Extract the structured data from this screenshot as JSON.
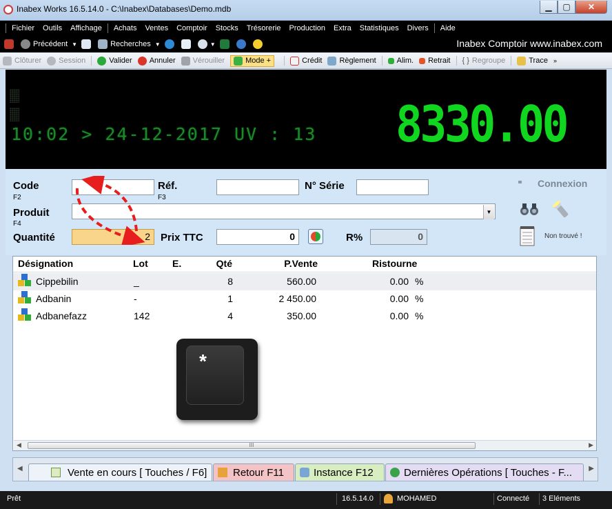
{
  "window": {
    "title": "Inabex Works 16.5.14.0 - C:\\Inabex\\Databases\\Demo.mdb"
  },
  "menu": [
    "Fichier",
    "Outils",
    "Affichage",
    "Achats",
    "Ventes",
    "Comptoir",
    "Stocks",
    "Trésorerie",
    "Production",
    "Extra",
    "Statistiques",
    "Divers",
    "Aide"
  ],
  "toolbar1": {
    "precedent": "Précédent",
    "recherches": "Recherches",
    "brand": "Inabex Comptoir  www.inabex.com"
  },
  "toolbar2": {
    "cloturer": "Clôturer",
    "session": "Session",
    "valider": "Valider",
    "annuler": "Annuler",
    "verouiller": "Vérouiller",
    "mode": "Mode +",
    "credit": "Crédit",
    "reglement": "Règlement",
    "alim": "Alim.",
    "retrait": "Retrait",
    "regroupe": "Regroupe",
    "trace": "Trace"
  },
  "display": {
    "line": "10:02 > 24-12-2017 UV : 13",
    "total": "8330.00"
  },
  "form": {
    "code_label": "Code",
    "code_key": "F2",
    "ref_label": "Réf.",
    "ref_key": "F3",
    "serie_label": "N° Série",
    "produit_label": "Produit",
    "produit_key": "F4",
    "quantite_label": "Quantité",
    "quantite_value": "2",
    "prix_label": "Prix TTC",
    "prix_value": "0",
    "remise_label": "R%",
    "remise_value": "0",
    "connexion": "Connexion",
    "non_trouve": "Non trouvé !"
  },
  "grid": {
    "headers": {
      "designation": "Désignation",
      "lot": "Lot",
      "e": "E.",
      "qte": "Qté",
      "pvente": "P.Vente",
      "ristourne": "Ristourne"
    },
    "rows": [
      {
        "designation": "Cippebilin",
        "lot": "_",
        "qte": "8",
        "pvente": "560.00",
        "ristourne": "0.00",
        "pct": "%"
      },
      {
        "designation": "Adbanin",
        "lot": "-",
        "qte": "1",
        "pvente": "2 450.00",
        "ristourne": "0.00",
        "pct": "%"
      },
      {
        "designation": "Adbanefazz",
        "lot": "142",
        "qte": "4",
        "pvente": "350.00",
        "ristourne": "0.00",
        "pct": "%"
      }
    ],
    "scroll_label": "III"
  },
  "key": {
    "symbol": "*"
  },
  "tabs": [
    "Vente en cours [ Touches / F6]",
    "Retour F11",
    "Instance F12",
    "Dernières Opérations [ Touches - F..."
  ],
  "status": {
    "state": "Prêt",
    "version": "16.5.14.0",
    "user": "MOHAMED",
    "connection": "Connecté",
    "count": "3 Eléments"
  },
  "colors": {
    "lcd_total": "#10d61f",
    "lcd_line": "#1b8a2a",
    "quantity_bg": "#f8d58a",
    "arrow": "#e61e1e"
  }
}
